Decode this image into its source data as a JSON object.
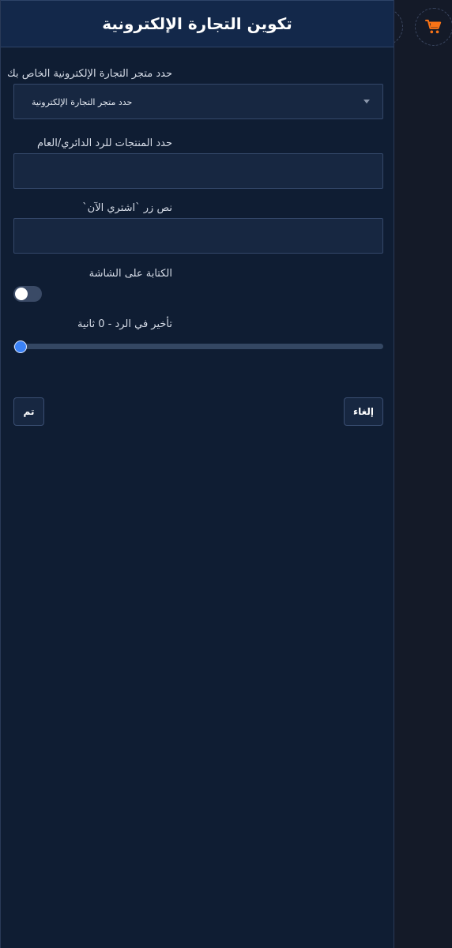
{
  "panel": {
    "title": "تكوين التجارة الإلكترونية"
  },
  "store": {
    "label": "حدد متجر التجارة الإلكترونية الخاص بك",
    "selected": "حدد متجر التجارة الإلكترونية"
  },
  "products": {
    "label": "حدد المنتجات للرد الدائري/العام",
    "value": ""
  },
  "buy_now": {
    "label": "نص زر `اشتري الآن`",
    "value": ""
  },
  "typing": {
    "label": "الكتابة على الشاشة",
    "enabled": false
  },
  "delay": {
    "label": "تأخير في الرد  -  0 ثانية",
    "value": 0
  },
  "actions": {
    "done": "تم",
    "cancel": "إلغاء"
  },
  "colors": {
    "panel_bg": "#0f1d33",
    "header_bg": "#13284a",
    "accent": "#3b82f6",
    "cart": "#f97316"
  },
  "icons": {
    "cart": "shopping-cart-icon"
  }
}
